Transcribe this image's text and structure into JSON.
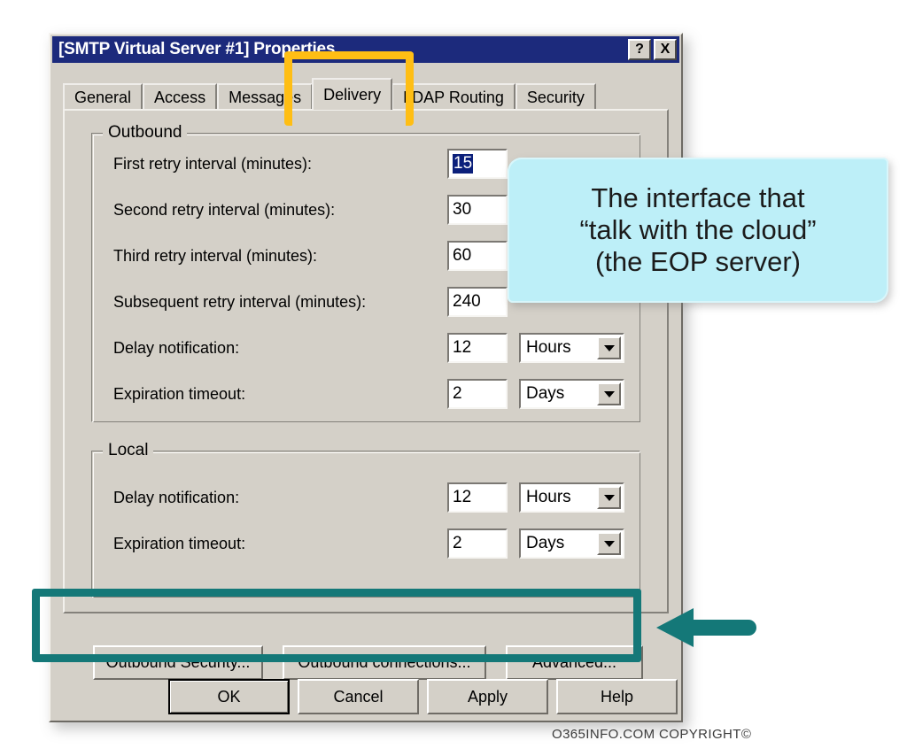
{
  "window": {
    "title": "[SMTP Virtual Server #1] Properties",
    "titlebar_buttons": [
      {
        "name": "help-button",
        "label": "?"
      },
      {
        "name": "close-button",
        "label": "X"
      }
    ],
    "titlebar_color": "#1c2a7c",
    "face_color": "#d4d0c8"
  },
  "tabs": [
    {
      "label": "General",
      "selected": false
    },
    {
      "label": "Access",
      "selected": false
    },
    {
      "label": "Messages",
      "selected": false
    },
    {
      "label": "Delivery",
      "selected": true
    },
    {
      "label": "LDAP Routing",
      "selected": false
    },
    {
      "label": "Security",
      "selected": false
    }
  ],
  "outbound": {
    "title": "Outbound",
    "fields": [
      {
        "label": "First retry interval (minutes):",
        "value": "15",
        "selected": true
      },
      {
        "label": "Second retry interval (minutes):",
        "value": "30",
        "selected": false
      },
      {
        "label": "Third retry interval (minutes):",
        "value": "60",
        "selected": false
      },
      {
        "label": "Subsequent retry interval (minutes):",
        "value": "240",
        "selected": false
      },
      {
        "label": "Delay notification:",
        "value": "12",
        "selected": false,
        "unit": "Hours"
      },
      {
        "label": "Expiration timeout:",
        "value": "2",
        "selected": false,
        "unit": "Days"
      }
    ]
  },
  "local": {
    "title": "Local",
    "fields": [
      {
        "label": "Delay notification:",
        "value": "12",
        "unit": "Hours"
      },
      {
        "label": "Expiration timeout:",
        "value": "2",
        "unit": "Days"
      }
    ]
  },
  "action_buttons": [
    {
      "label": "Outbound Security...",
      "name": "outbound-security-button"
    },
    {
      "label": "Outbound connections...",
      "name": "outbound-connections-button"
    },
    {
      "label": "Advanced...",
      "name": "advanced-button"
    }
  ],
  "dialog_buttons": [
    {
      "label": "OK",
      "name": "ok-button",
      "default": true
    },
    {
      "label": "Cancel",
      "name": "cancel-button",
      "default": false
    },
    {
      "label": "Apply",
      "name": "apply-button",
      "default": false
    },
    {
      "label": "Help",
      "name": "help-button",
      "default": false
    }
  ],
  "annotations": {
    "callout_lines": [
      "The interface that",
      "“talk with the cloud”",
      "(the EOP server)"
    ],
    "callout_color": "#bdeff8",
    "highlight_tab_color": "#ffbe14",
    "highlight_buttons_color": "#147878"
  },
  "footer": {
    "copyright": "O365INFO.COM COPYRIGHT©"
  }
}
